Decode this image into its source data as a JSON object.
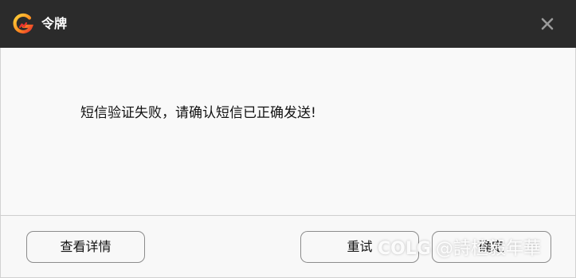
{
  "window": {
    "title": "令牌",
    "close_icon": "close-icon",
    "logo_icon": "app-logo-icon",
    "titlebar_color": "#2b2b2b"
  },
  "content": {
    "message": "短信验证失败，请确认短信已正确发送!"
  },
  "footer": {
    "details_label": "查看详情",
    "retry_label": "重试",
    "confirm_label": "确定"
  },
  "watermark": {
    "logo_text": "COLG",
    "text": "@詩楂毅年華"
  }
}
